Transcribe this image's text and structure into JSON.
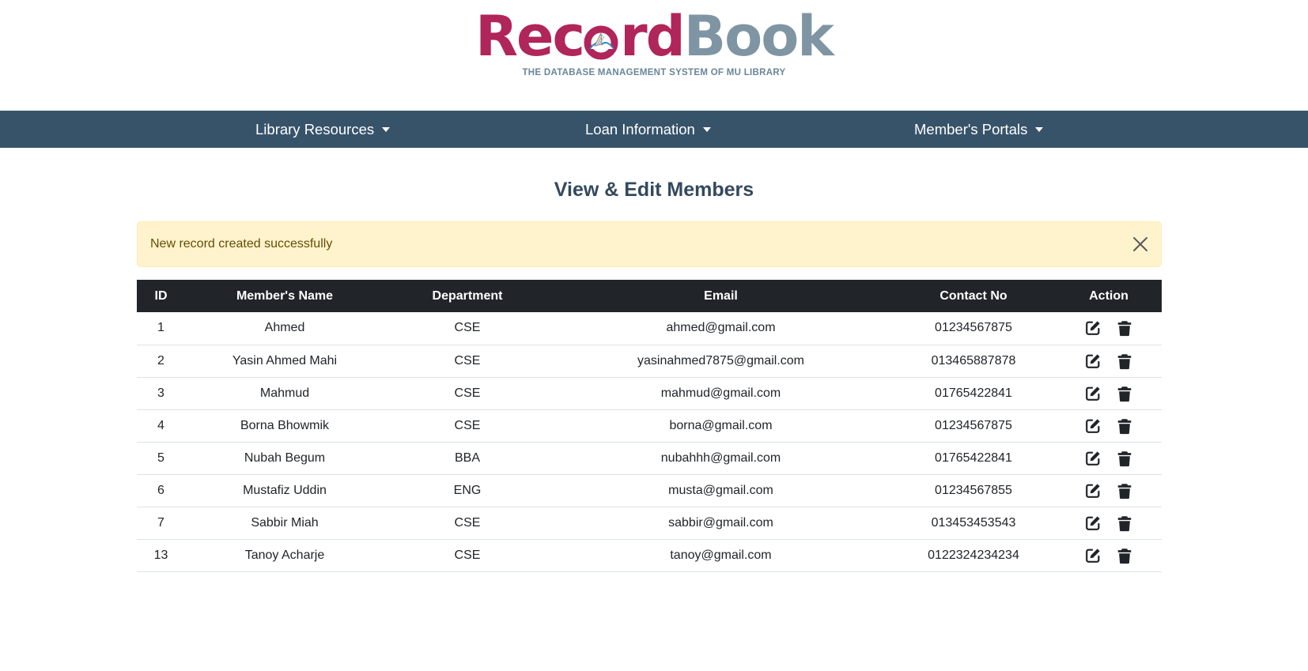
{
  "logo": {
    "part1": "Rec",
    "part2": "rd",
    "part3": "Book",
    "tagline": "THE DATABASE MANAGEMENT SYSTEM OF MU LIBRARY",
    "colors": {
      "record": "#b0255a",
      "book": "#7f95a3",
      "tagline": "#6a8597"
    }
  },
  "nav": {
    "items": [
      {
        "label": "Library Resources"
      },
      {
        "label": "Loan Information"
      },
      {
        "label": "Member's Portals"
      }
    ],
    "background": "#37536a"
  },
  "page": {
    "title": "View & Edit Members"
  },
  "alert": {
    "message": "New record created successfully",
    "close_icon": "close-icon"
  },
  "table": {
    "headers": [
      "ID",
      "Member's Name",
      "Department",
      "Email",
      "Contact No",
      "Action"
    ],
    "rows": [
      {
        "id": "1",
        "name": "Ahmed",
        "department": "CSE",
        "email": "ahmed@gmail.com",
        "contact": "01234567875"
      },
      {
        "id": "2",
        "name": "Yasin Ahmed Mahi",
        "department": "CSE",
        "email": "yasinahmed7875@gmail.com",
        "contact": "013465887878"
      },
      {
        "id": "3",
        "name": "Mahmud",
        "department": "CSE",
        "email": "mahmud@gmail.com",
        "contact": "01765422841"
      },
      {
        "id": "4",
        "name": "Borna Bhowmik",
        "department": "CSE",
        "email": "borna@gmail.com",
        "contact": "01234567875"
      },
      {
        "id": "5",
        "name": "Nubah Begum",
        "department": "BBA",
        "email": "nubahhh@gmail.com",
        "contact": "01765422841"
      },
      {
        "id": "6",
        "name": "Mustafiz Uddin",
        "department": "ENG",
        "email": "musta@gmail.com",
        "contact": "01234567855"
      },
      {
        "id": "7",
        "name": "Sabbir Miah",
        "department": "CSE",
        "email": "sabbir@gmail.com",
        "contact": "013453453543"
      },
      {
        "id": "13",
        "name": "Tanoy Acharje",
        "department": "CSE",
        "email": "tanoy@gmail.com",
        "contact": "0122324234234"
      }
    ],
    "action_icons": [
      "edit-icon",
      "trash-icon"
    ]
  }
}
